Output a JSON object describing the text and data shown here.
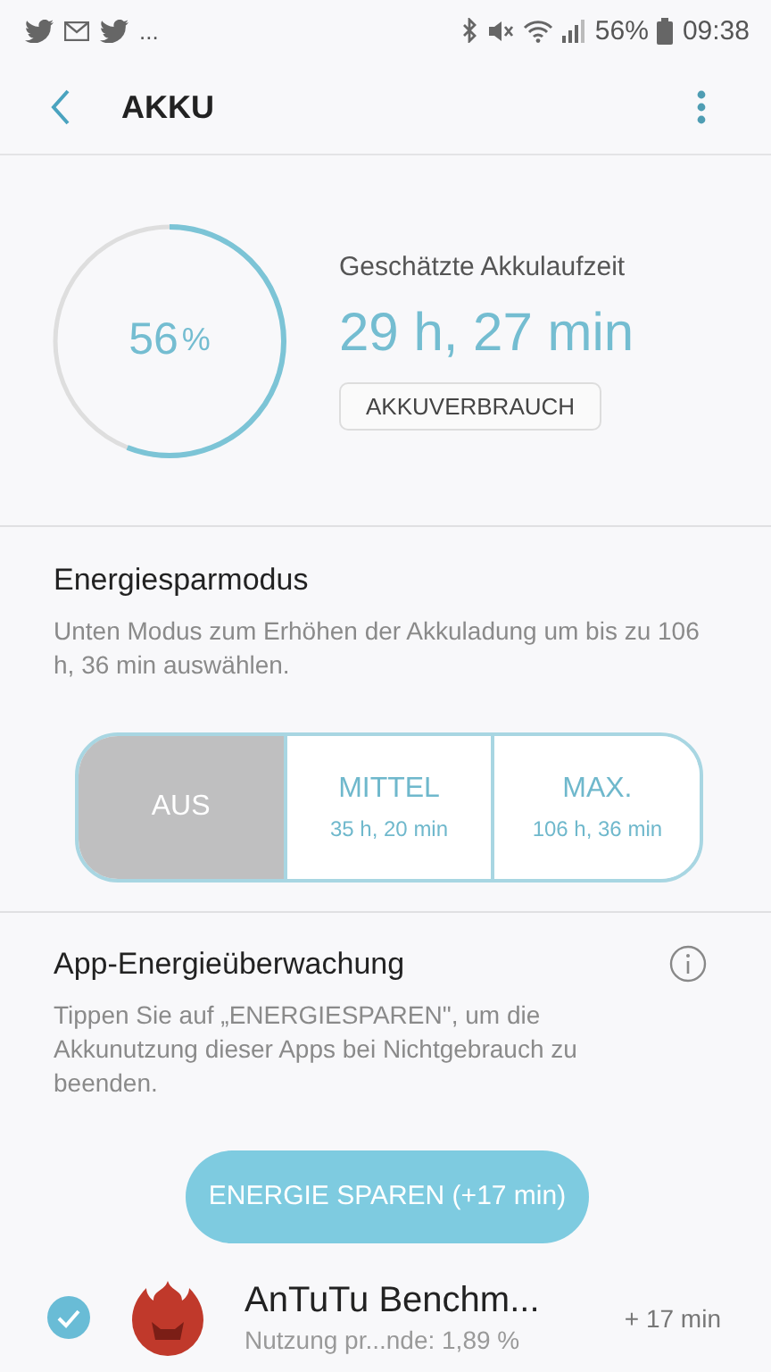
{
  "status_bar": {
    "notification_overflow": "...",
    "battery_percent": "56%",
    "time": "09:38"
  },
  "app_bar": {
    "title": "AKKU"
  },
  "battery": {
    "percent": "56",
    "percent_unit": "%",
    "estimate_label": "Geschätzte Akkulaufzeit",
    "estimate": "29 h, 27 min",
    "usage_button": "AKKUVERBRAUCH"
  },
  "power_saving": {
    "title": "Energiesparmodus",
    "description": "Unten Modus zum Erhöhen der Akkuladung um bis zu 106 h, 36 min auswählen.",
    "modes": [
      {
        "label": "AUS",
        "selected": true
      },
      {
        "label": "MITTEL",
        "time": "35 h, 20 min",
        "selected": false
      },
      {
        "label": "MAX.",
        "time": "106 h, 36 min",
        "selected": false
      }
    ]
  },
  "app_monitor": {
    "title": "App-Energieüberwachung",
    "description": "Tippen Sie auf „ENERGIESPAREN\", um die Akkunutzung dieser Apps bei Nichtgebrauch zu beenden.",
    "save_button": "ENERGIE SPAREN (+17 min)",
    "apps": [
      {
        "name": "AnTuTu Benchm...",
        "usage": "Nutzung pr...nde: 1,89 %",
        "gain": "+ 17 min",
        "checked": true
      }
    ]
  }
}
